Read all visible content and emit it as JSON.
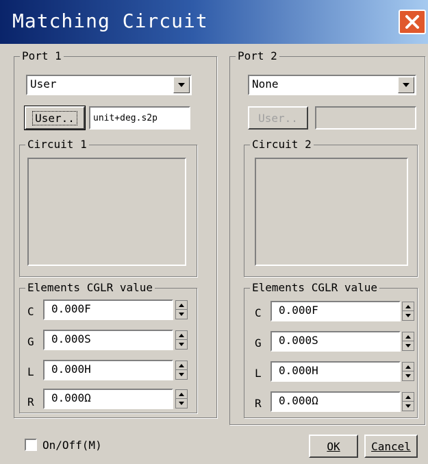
{
  "window": {
    "title": "Matching Circuit"
  },
  "port1": {
    "label": "Port 1",
    "selected": "User",
    "user_button": "User..",
    "file": "unit+deg.s2p",
    "circuit_label": "Circuit 1",
    "elements_label": "Elements CGLR value",
    "elements": [
      {
        "name": "C",
        "value": "0.000F"
      },
      {
        "name": "G",
        "value": "0.000S"
      },
      {
        "name": "L",
        "value": "0.000H"
      },
      {
        "name": "R",
        "value": "0.000Ω"
      }
    ]
  },
  "port2": {
    "label": "Port 2",
    "selected": "None",
    "user_button": "User..",
    "file": "",
    "circuit_label": "Circuit 2",
    "elements_label": "Elements CGLR value",
    "elements": [
      {
        "name": "C",
        "value": "0.000F"
      },
      {
        "name": "G",
        "value": "0.000S"
      },
      {
        "name": "L",
        "value": "0.000H"
      },
      {
        "name": "R",
        "value": "0.000Ω"
      }
    ]
  },
  "footer": {
    "onoff_label": "On/Off(M)",
    "onoff_checked": false,
    "ok_label": "OK",
    "cancel_label": "Cancel"
  },
  "icons": {
    "close": "close-icon",
    "dropdown": "chevron-down-icon",
    "spin_up": "spin-up-icon",
    "spin_down": "spin-down-icon"
  },
  "colors": {
    "titlebar_start": "#0a246a",
    "titlebar_end": "#a6caf0",
    "close_button": "#e0582c",
    "dialog_bg": "#d4d0c8"
  }
}
